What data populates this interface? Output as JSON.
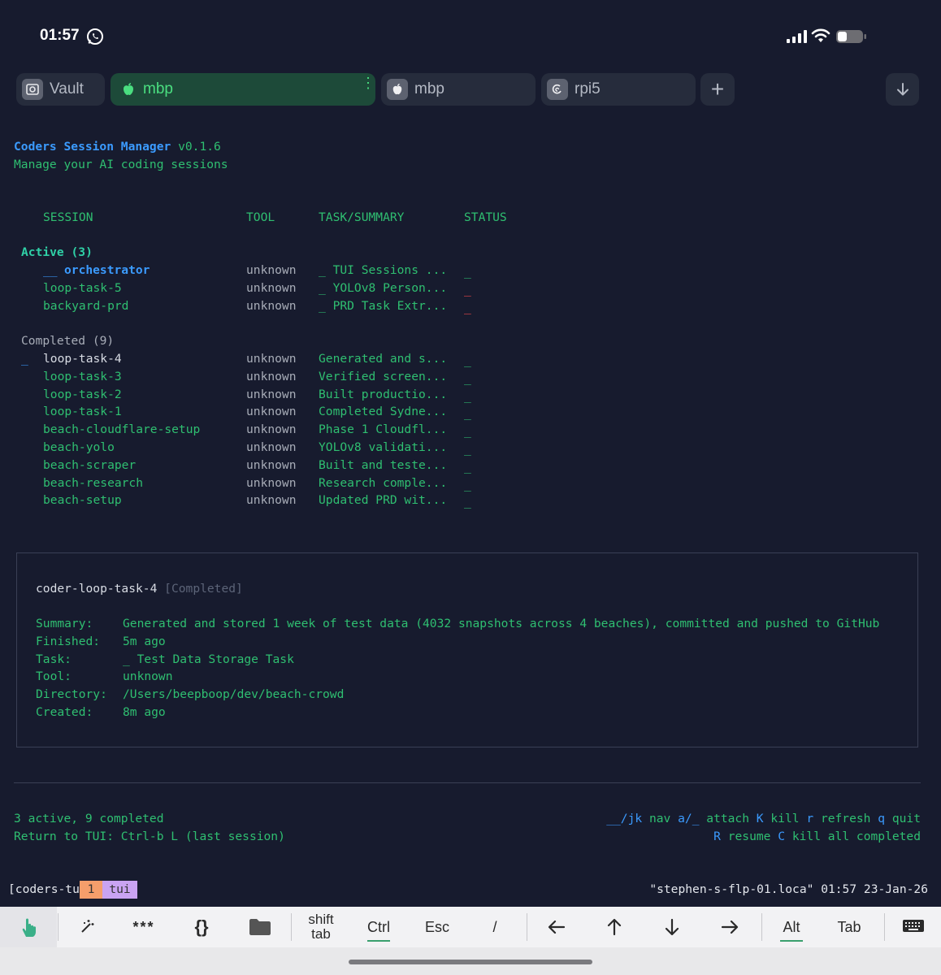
{
  "status_bar": {
    "time": "01:57",
    "icons": [
      "whatsapp-icon",
      "signal-icon",
      "wifi-icon",
      "battery-icon"
    ]
  },
  "tabs": [
    {
      "label": "Vault",
      "icon": "vault-icon",
      "active": false
    },
    {
      "label": "mbp",
      "icon": "apple-icon",
      "active": true
    },
    {
      "label": "mbp",
      "icon": "apple-icon",
      "active": false
    },
    {
      "label": "rpi5",
      "icon": "debian-icon",
      "active": false
    }
  ],
  "tab_add_label": "+",
  "colors": {
    "background": "#171b2e",
    "accent_green": "#2fbf71",
    "accent_blue": "#3b9bff",
    "status_red": "#ff4b4b",
    "tmux_window_num_bg": "#f59e6b",
    "tmux_window_name_bg": "#c9a3f2"
  },
  "app": {
    "name": "Coders Session Manager",
    "version": "v0.1.6",
    "subtitle": "Manage your AI coding sessions"
  },
  "table": {
    "headers": [
      "SESSION",
      "TOOL",
      "TASK/SUMMARY",
      "STATUS"
    ],
    "active": {
      "label": "Active (3)",
      "rows": [
        {
          "prefix": "__",
          "name": "orchestrator",
          "tool": "unknown",
          "task": "_ TUI Sessions ...",
          "status": "_",
          "status_color": "green"
        },
        {
          "prefix": "",
          "name": "loop-task-5",
          "tool": "unknown",
          "task": "_ YOLOv8 Person...",
          "status": "_",
          "status_color": "red"
        },
        {
          "prefix": "",
          "name": "backyard-prd",
          "tool": "unknown",
          "task": "_ PRD Task Extr...",
          "status": "_",
          "status_color": "red"
        }
      ]
    },
    "completed": {
      "label": "Completed (9)",
      "rows": [
        {
          "prefix": "_",
          "name": "loop-task-4",
          "tool": "unknown",
          "task": "Generated and s...",
          "status": "_"
        },
        {
          "prefix": "",
          "name": "loop-task-3",
          "tool": "unknown",
          "task": "Verified screen...",
          "status": "_"
        },
        {
          "prefix": "",
          "name": "loop-task-2",
          "tool": "unknown",
          "task": "Built productio...",
          "status": "_"
        },
        {
          "prefix": "",
          "name": "loop-task-1",
          "tool": "unknown",
          "task": "Completed Sydne...",
          "status": "_"
        },
        {
          "prefix": "",
          "name": "beach-cloudflare-setup",
          "tool": "unknown",
          "task": "Phase 1 Cloudfl...",
          "status": "_"
        },
        {
          "prefix": "",
          "name": "beach-yolo",
          "tool": "unknown",
          "task": "YOLOv8 validati...",
          "status": "_"
        },
        {
          "prefix": "",
          "name": "beach-scraper",
          "tool": "unknown",
          "task": "Built and teste...",
          "status": "_"
        },
        {
          "prefix": "",
          "name": "beach-research",
          "tool": "unknown",
          "task": "Research comple...",
          "status": "_"
        },
        {
          "prefix": "",
          "name": "beach-setup",
          "tool": "unknown",
          "task": "Updated PRD wit...",
          "status": "_"
        }
      ]
    }
  },
  "detail": {
    "title": "coder-loop-task-4",
    "state": "[Completed]",
    "fields": [
      {
        "label": "Summary:",
        "value": "Generated and stored 1 week of test data (4032 snapshots across 4 beaches), committed and pushed to GitHub"
      },
      {
        "label": "Finished:",
        "value": "5m ago"
      },
      {
        "label": "Task:",
        "value": "_ Test Data Storage Task"
      },
      {
        "label": "Tool:",
        "value": "unknown"
      },
      {
        "label": "Directory:",
        "value": "/Users/beepboop/dev/beach-crowd"
      },
      {
        "label": "Created:",
        "value": "8m ago"
      }
    ]
  },
  "footer": {
    "counts": "3 active, 9 completed",
    "return_hint": "Return to TUI: Ctrl-b L (last session)",
    "shortcuts_line1": [
      {
        "key": "__/jk",
        "desc": "nav"
      },
      {
        "key": "a/_",
        "desc": "attach"
      },
      {
        "key": "K",
        "desc": "kill"
      },
      {
        "key": "r",
        "desc": "refresh"
      },
      {
        "key": "q",
        "desc": "quit"
      }
    ],
    "shortcuts_line2": [
      {
        "key": "R",
        "desc": "resume"
      },
      {
        "key": "C",
        "desc": "kill all completed"
      }
    ]
  },
  "tmux": {
    "session": "[coders-tu",
    "window_num": "1",
    "window_name": "tui",
    "right": "\"stephen-s-flp-01.loca\" 01:57 23-Jan-26"
  },
  "keys": {
    "touch": "touch-icon",
    "magic": "magic-wand-icon",
    "password": "***",
    "braces": "{}",
    "folder": "folder-icon",
    "shift_tab_1": "shift",
    "shift_tab_2": "tab",
    "ctrl": "Ctrl",
    "esc": "Esc",
    "slash": "/",
    "left": "left-arrow-icon",
    "up": "up-arrow-icon",
    "down": "down-arrow-icon",
    "right": "right-arrow-icon",
    "alt": "Alt",
    "tab": "Tab",
    "keyboard": "keyboard-icon"
  }
}
